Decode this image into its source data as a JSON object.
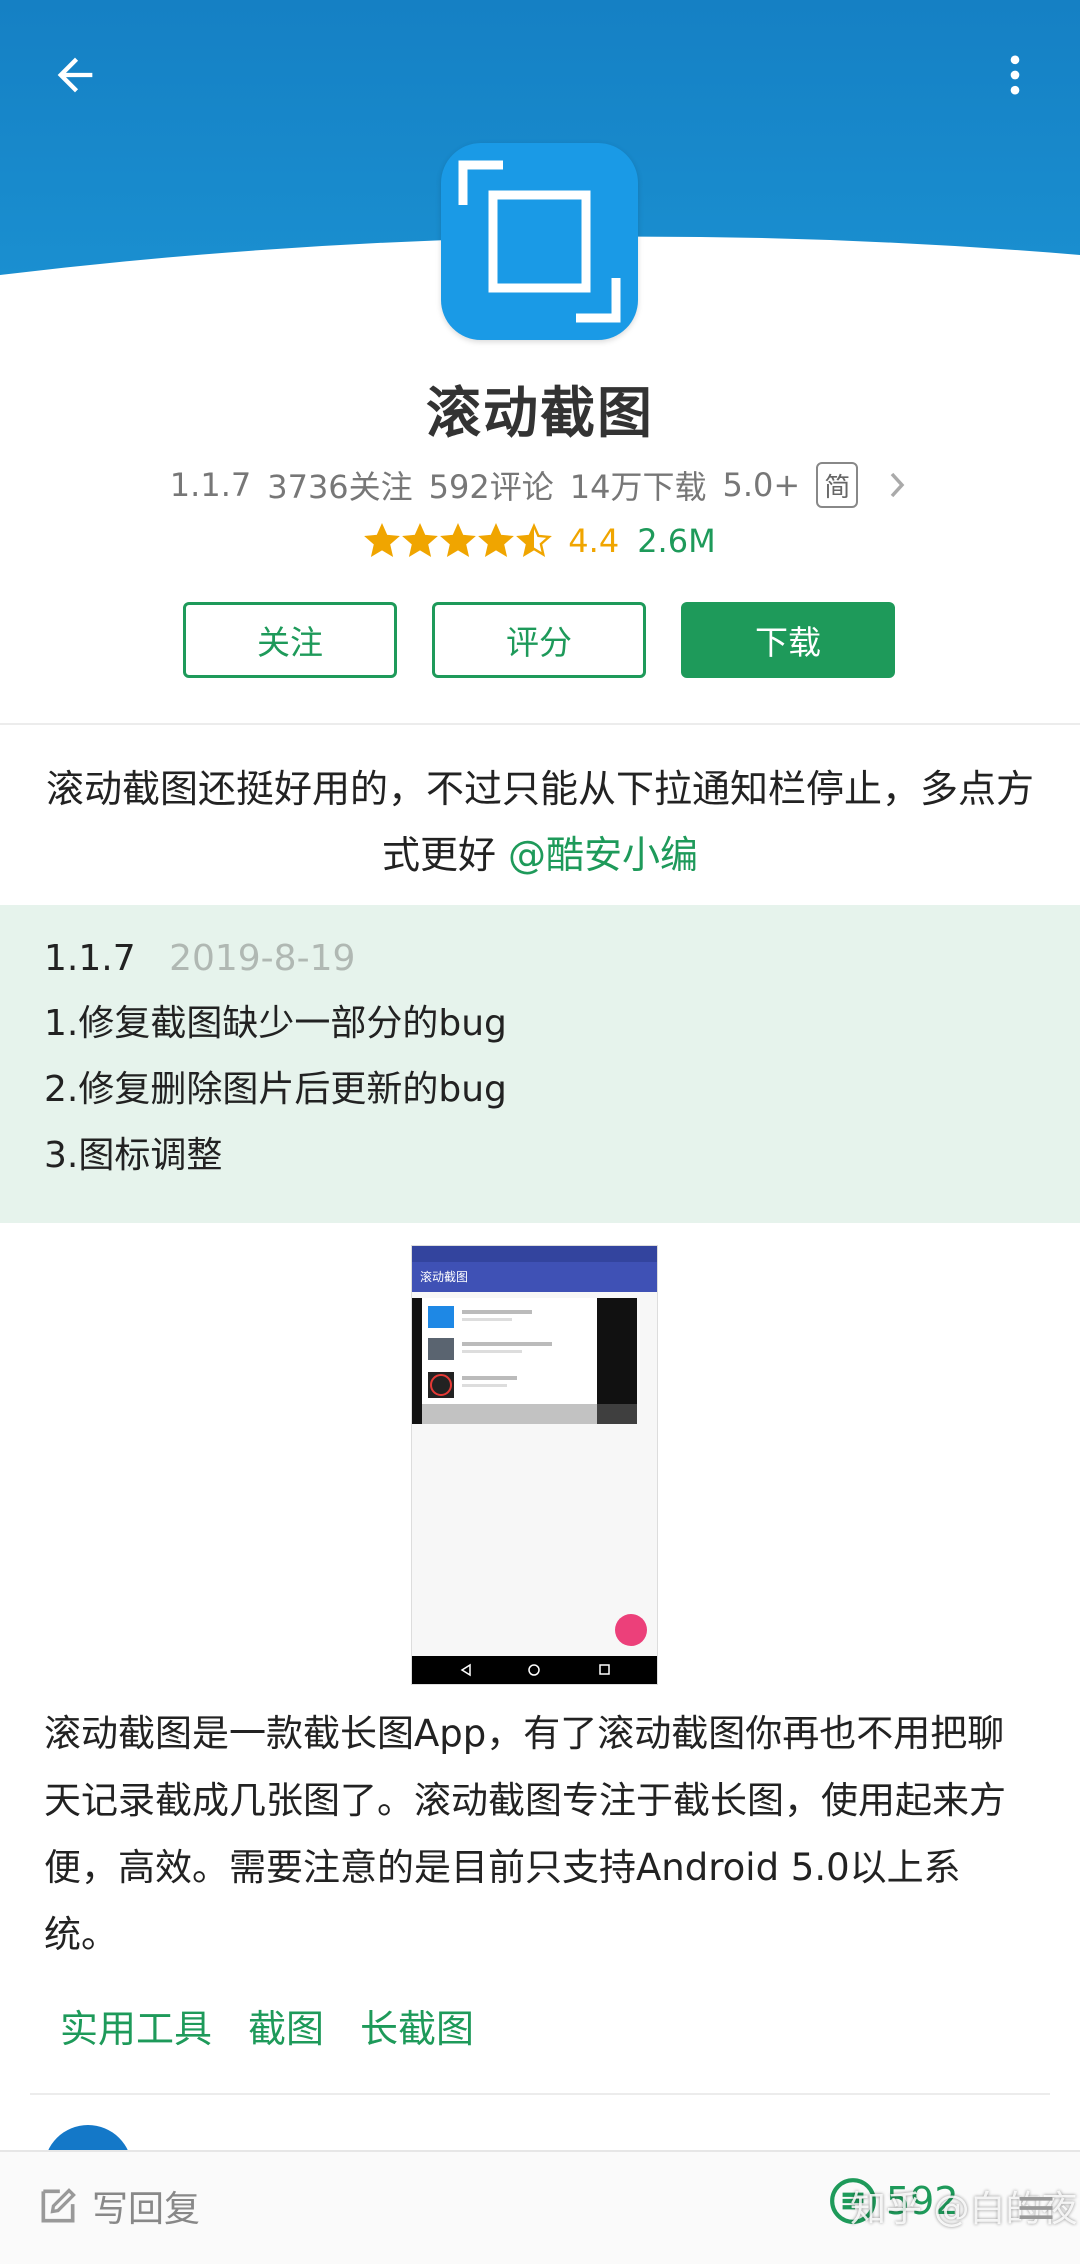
{
  "colors": {
    "header_blue": "#1a86c8",
    "accent_green": "#1e9a5a",
    "star_gold": "#f0a500",
    "changelog_bg": "#e6f3ec"
  },
  "topbar": {
    "back_icon": "arrow-left-icon",
    "more_icon": "more-vertical-icon"
  },
  "app": {
    "title": "滚动截图",
    "version": "1.1.7",
    "followers": "3736关注",
    "comments": "592评论",
    "downloads": "14万下载",
    "android_req": "5.0+",
    "lang_badge": "简",
    "rating_score": 4.4,
    "rating": "4.4",
    "size": "2.6M"
  },
  "actions": {
    "follow": "关注",
    "rate": "评分",
    "download": "下载"
  },
  "editor_comment": {
    "text": "滚动截图还挺好用的，不过只能从下拉通知栏停止，多点方式更好 ",
    "mention": "@酷安小编"
  },
  "changelog": {
    "version": "1.1.7",
    "date": "2019-8-19",
    "items": [
      "1.修复截图缺少一部分的bug",
      "2.修复删除图片后更新的bug",
      "3.图标调整"
    ]
  },
  "screenshot": {
    "toolbar_title": "滚动截图"
  },
  "description": "滚动截图是一款截长图App，有了滚动截图你再也不用把聊天记录截成几张图了。滚动截图专注于截长图，使用起来方便，高效。需要注意的是目前只支持Android 5.0以上系统。",
  "tags": [
    "实用工具",
    "截图",
    "长截图"
  ],
  "bottom_bar": {
    "reply_label": "写回复",
    "comment_count": "592",
    "watermark": "知乎 @白的夜"
  }
}
